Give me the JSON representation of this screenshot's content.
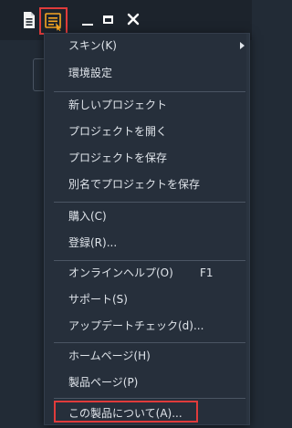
{
  "colors": {
    "highlight_border": "#e03b3b",
    "menu_bg": "#262f3b",
    "titlebar_bg": "#1c232c",
    "menu_icon_accent": "#f5a623"
  },
  "titlebar": {
    "icons": [
      "document-icon",
      "menu-icon",
      "minimize-icon",
      "maximize-icon",
      "close-icon"
    ]
  },
  "menu": {
    "items": [
      {
        "label": "スキン(K)",
        "shortcut": "",
        "submenu": true
      },
      {
        "label": "環境設定",
        "shortcut": ""
      },
      {
        "label": "新しいプロジェクト",
        "shortcut": ""
      },
      {
        "label": "プロジェクトを開く",
        "shortcut": ""
      },
      {
        "label": "プロジェクトを保存",
        "shortcut": ""
      },
      {
        "label": "別名でプロジェクトを保存",
        "shortcut": ""
      },
      {
        "label": "購入(C)",
        "shortcut": ""
      },
      {
        "label": "登録(R)...",
        "shortcut": ""
      },
      {
        "label": "オンラインヘルプ(O)",
        "shortcut": "F1"
      },
      {
        "label": "サポート(S)",
        "shortcut": ""
      },
      {
        "label": "アップデートチェック(d)...",
        "shortcut": ""
      },
      {
        "label": "ホームページ(H)",
        "shortcut": ""
      },
      {
        "label": "製品ページ(P)",
        "shortcut": ""
      },
      {
        "label": "この製品について(A)...",
        "shortcut": "",
        "highlighted": true
      }
    ]
  }
}
